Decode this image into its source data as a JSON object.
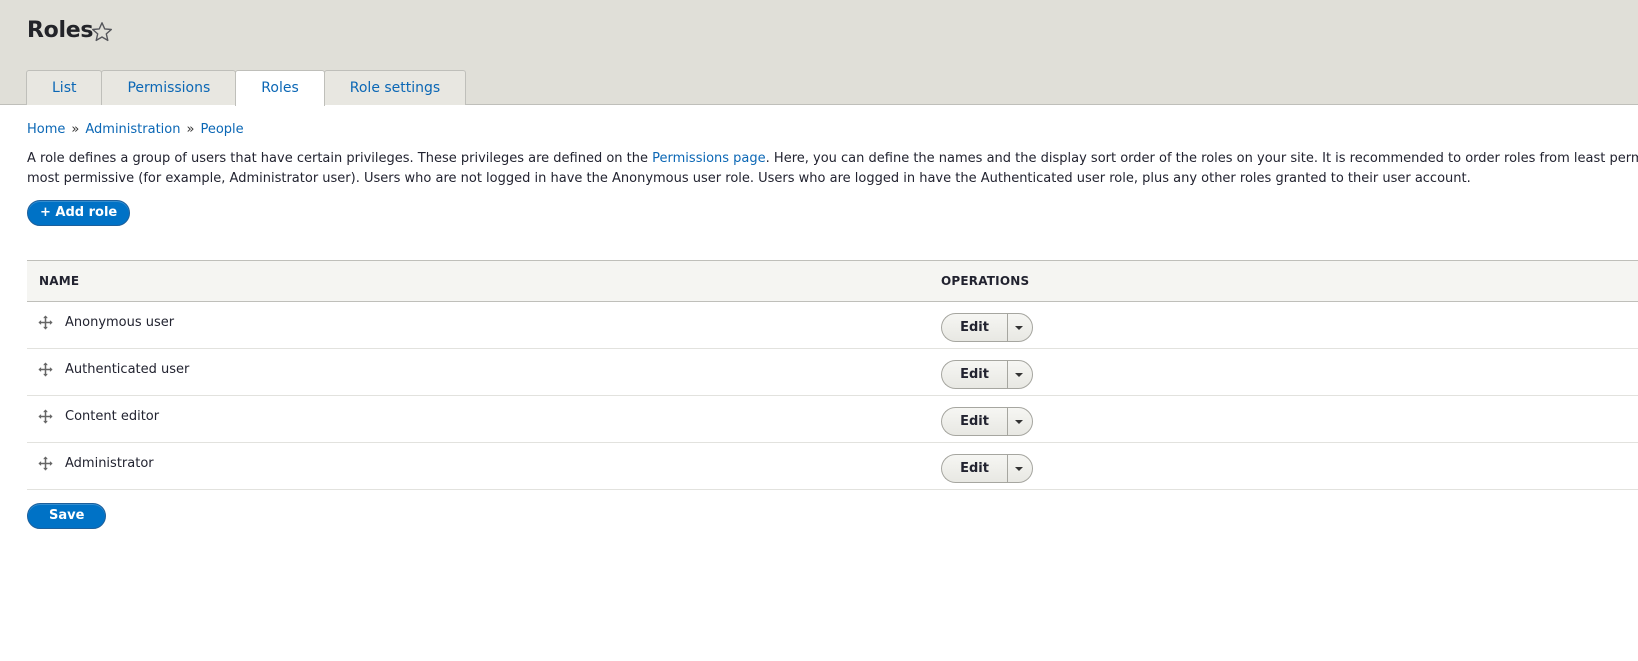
{
  "header": {
    "title": "Roles",
    "tabs": [
      {
        "label": "List"
      },
      {
        "label": "Permissions"
      },
      {
        "label": "Roles",
        "active": true
      },
      {
        "label": "Role settings"
      }
    ]
  },
  "breadcrumb": {
    "items": [
      "Home",
      "Administration",
      "People"
    ],
    "separator": "»"
  },
  "description": {
    "part1": "A role defines a group of users that have certain privileges. These privileges are defined on the ",
    "link": "Permissions page",
    "part2": ". Here, you can define the names and the display sort order of the roles on your site. It is recommended to order roles from least permissive (f",
    "line2": "most permissive (for example, Administrator user). Users who are not logged in have the Anonymous user role. Users who are logged in have the Authenticated user role, plus any other roles granted to their user account."
  },
  "actions": {
    "add_role": "+ Add role",
    "save": "Save"
  },
  "table": {
    "headers": {
      "name": "NAME",
      "operations": "OPERATIONS"
    },
    "rows": [
      {
        "name": "Anonymous user",
        "edit": "Edit"
      },
      {
        "name": "Authenticated user",
        "edit": "Edit"
      },
      {
        "name": "Content editor",
        "edit": "Edit"
      },
      {
        "name": "Administrator",
        "edit": "Edit"
      }
    ]
  },
  "icons": {
    "star": "star-outline-icon",
    "drag": "drag-handle-icon",
    "dropdown": "caret-down-icon"
  },
  "colors": {
    "link": "#0b67b5",
    "primary": "#0072c6",
    "header_bg": "#e0dfd8"
  }
}
